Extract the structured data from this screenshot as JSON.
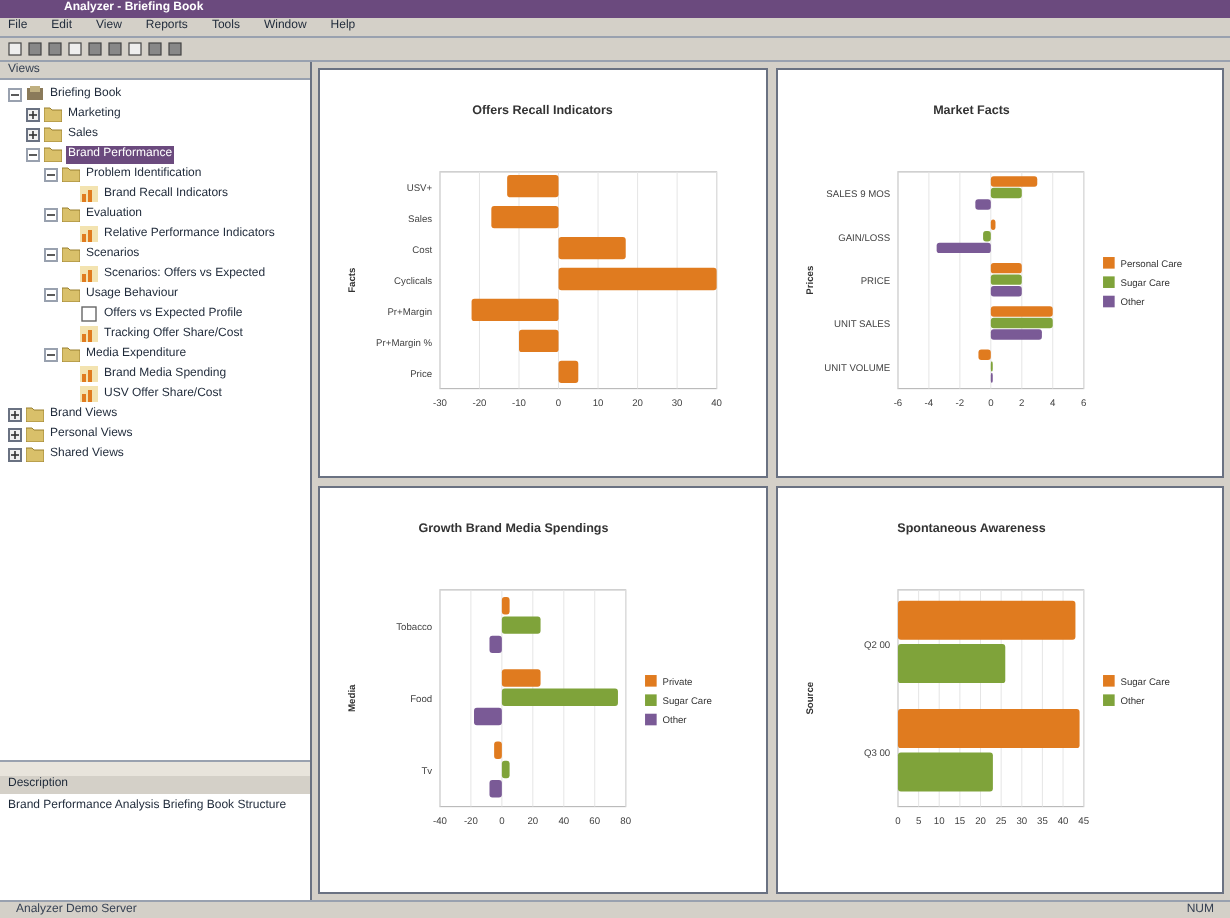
{
  "window": {
    "title": "Analyzer - Briefing Book"
  },
  "menu": [
    "File",
    "Edit",
    "View",
    "Reports",
    "Tools",
    "Window",
    "Help"
  ],
  "sidebar": {
    "title": "Views",
    "tree": [
      {
        "label": "Briefing Book",
        "kind": "book",
        "expanded": true,
        "selected": false,
        "children": [
          {
            "label": "Marketing",
            "kind": "folder",
            "expanded": false,
            "selected": false
          },
          {
            "label": "Sales",
            "kind": "folder",
            "expanded": false,
            "selected": false
          },
          {
            "label": "Brand Performance",
            "kind": "folder",
            "expanded": true,
            "selected": true,
            "children": [
              {
                "label": "Problem Identification",
                "kind": "folder",
                "expanded": true,
                "selected": false,
                "children": [
                  {
                    "label": "Brand Recall Indicators",
                    "kind": "chart",
                    "selected": false
                  }
                ]
              },
              {
                "label": "Evaluation",
                "kind": "folder",
                "expanded": true,
                "selected": false,
                "children": [
                  {
                    "label": "Relative Performance Indicators",
                    "kind": "chart",
                    "selected": false
                  }
                ]
              },
              {
                "label": "Scenarios",
                "kind": "folder",
                "expanded": true,
                "selected": false,
                "children": [
                  {
                    "label": "Scenarios: Offers vs Expected",
                    "kind": "chart",
                    "selected": false
                  }
                ]
              },
              {
                "label": "Usage Behaviour",
                "kind": "folder",
                "expanded": true,
                "selected": false,
                "children": [
                  {
                    "label": "Offers vs Expected Profile",
                    "kind": "page",
                    "selected": false
                  },
                  {
                    "label": "Tracking Offer Share/Cost",
                    "kind": "chart",
                    "selected": false
                  }
                ]
              },
              {
                "label": "Media Expenditure",
                "kind": "folder",
                "expanded": true,
                "selected": false,
                "children": [
                  {
                    "label": "Brand Media Spending",
                    "kind": "chart",
                    "selected": false
                  },
                  {
                    "label": "USV Offer Share/Cost",
                    "kind": "chart",
                    "selected": false
                  }
                ]
              }
            ]
          }
        ]
      },
      {
        "label": "Brand Views",
        "kind": "folder",
        "expanded": false,
        "selected": false
      },
      {
        "label": "Personal Views",
        "kind": "folder",
        "expanded": false,
        "selected": false
      },
      {
        "label": "Shared Views",
        "kind": "folder",
        "expanded": false,
        "selected": false
      }
    ]
  },
  "description": {
    "title": "Description",
    "text": "Brand Performance Analysis Briefing Book Structure"
  },
  "charts": [
    {
      "chart_data": {
        "type": "bar",
        "orientation": "horizontal",
        "title": "Offers Recall Indicators",
        "ylabel": "Facts",
        "categories": [
          "USV+",
          "Sales",
          "Cost",
          "Cyclicals",
          "Pr+Margin",
          "Pr+Margin %",
          "Price"
        ],
        "series": [
          {
            "color": "#e07b1f",
            "values": [
              -13,
              -17,
              17,
              40,
              -22,
              -10,
              5
            ]
          }
        ],
        "xlim": [
          -30,
          40
        ],
        "xticks": [
          -30,
          -20,
          -10,
          0,
          10,
          20,
          30,
          40
        ],
        "grid": true
      }
    },
    {
      "chart_data": {
        "type": "bar",
        "orientation": "horizontal",
        "title": "Market Facts",
        "ylabel": "Prices",
        "categories": [
          "SALES 9 MOS",
          "GAIN/LOSS",
          "PRICE",
          "UNIT SALES",
          "UNIT VOLUME"
        ],
        "series": [
          {
            "name": "Personal Care",
            "color": "#e07b1f",
            "values": [
              3,
              0.3,
              2,
              4,
              -0.8
            ]
          },
          {
            "name": "Sugar Care",
            "color": "#7fa33a",
            "values": [
              2,
              -0.5,
              2,
              4,
              0
            ]
          },
          {
            "name": "Other",
            "color": "#7a5a96",
            "values": [
              -1,
              -3.5,
              2,
              3.3,
              0
            ]
          }
        ],
        "xlim": [
          -6,
          6
        ],
        "xticks": [
          -6,
          -4,
          -2,
          0,
          2,
          4,
          6
        ],
        "grid": true,
        "legend": "right"
      }
    },
    {
      "chart_data": {
        "type": "bar",
        "orientation": "horizontal",
        "title": "Growth Brand Media Spendings",
        "ylabel": "Media",
        "categories": [
          "Tobacco",
          "Food",
          "Tv"
        ],
        "series": [
          {
            "name": "Private",
            "color": "#e07b1f",
            "values": [
              5,
              25,
              -5
            ]
          },
          {
            "name": "Sugar Care",
            "color": "#7fa33a",
            "values": [
              25,
              75,
              5
            ]
          },
          {
            "name": "Other",
            "color": "#7a5a96",
            "values": [
              -8,
              -18,
              -8
            ]
          }
        ],
        "xlim": [
          -40,
          80
        ],
        "xticks": [
          -40,
          -20,
          0,
          20,
          40,
          60,
          80
        ],
        "grid": true,
        "legend": "right"
      }
    },
    {
      "chart_data": {
        "type": "bar",
        "orientation": "horizontal",
        "title": "Spontaneous Awareness",
        "ylabel": "Source",
        "categories": [
          "Q2 00",
          "Q3 00"
        ],
        "series": [
          {
            "name": "Sugar Care",
            "color": "#e07b1f",
            "values": [
              43,
              44
            ]
          },
          {
            "name": "Other",
            "color": "#7fa33a",
            "values": [
              26,
              23
            ]
          }
        ],
        "xlim": [
          0,
          45
        ],
        "xticks": [
          0,
          5,
          10,
          15,
          20,
          25,
          30,
          35,
          40,
          45
        ],
        "grid": true,
        "legend": "right"
      }
    }
  ],
  "status_bar": [
    "Analyzer Demo Server",
    "NUM"
  ]
}
